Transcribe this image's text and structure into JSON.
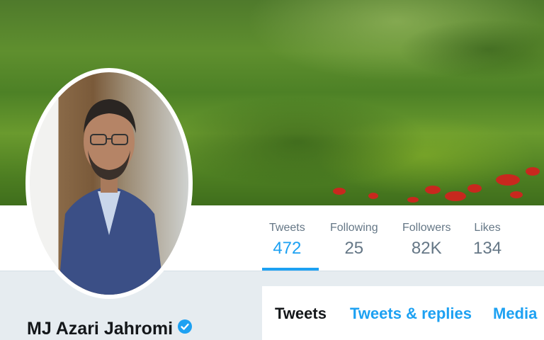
{
  "profile": {
    "name": "MJ Azari Jahromi",
    "verified": true
  },
  "stats": [
    {
      "label": "Tweets",
      "value": "472",
      "active": true
    },
    {
      "label": "Following",
      "value": "25",
      "active": false
    },
    {
      "label": "Followers",
      "value": "82K",
      "active": false
    },
    {
      "label": "Likes",
      "value": "134",
      "active": false
    }
  ],
  "tabs": [
    {
      "label": "Tweets",
      "active": true
    },
    {
      "label": "Tweets & replies",
      "active": false
    },
    {
      "label": "Media",
      "active": false
    }
  ],
  "colors": {
    "accent": "#1da1f2",
    "text": "#14171a",
    "muted": "#657786"
  },
  "icons": {
    "verified": "verified-badge-icon"
  }
}
